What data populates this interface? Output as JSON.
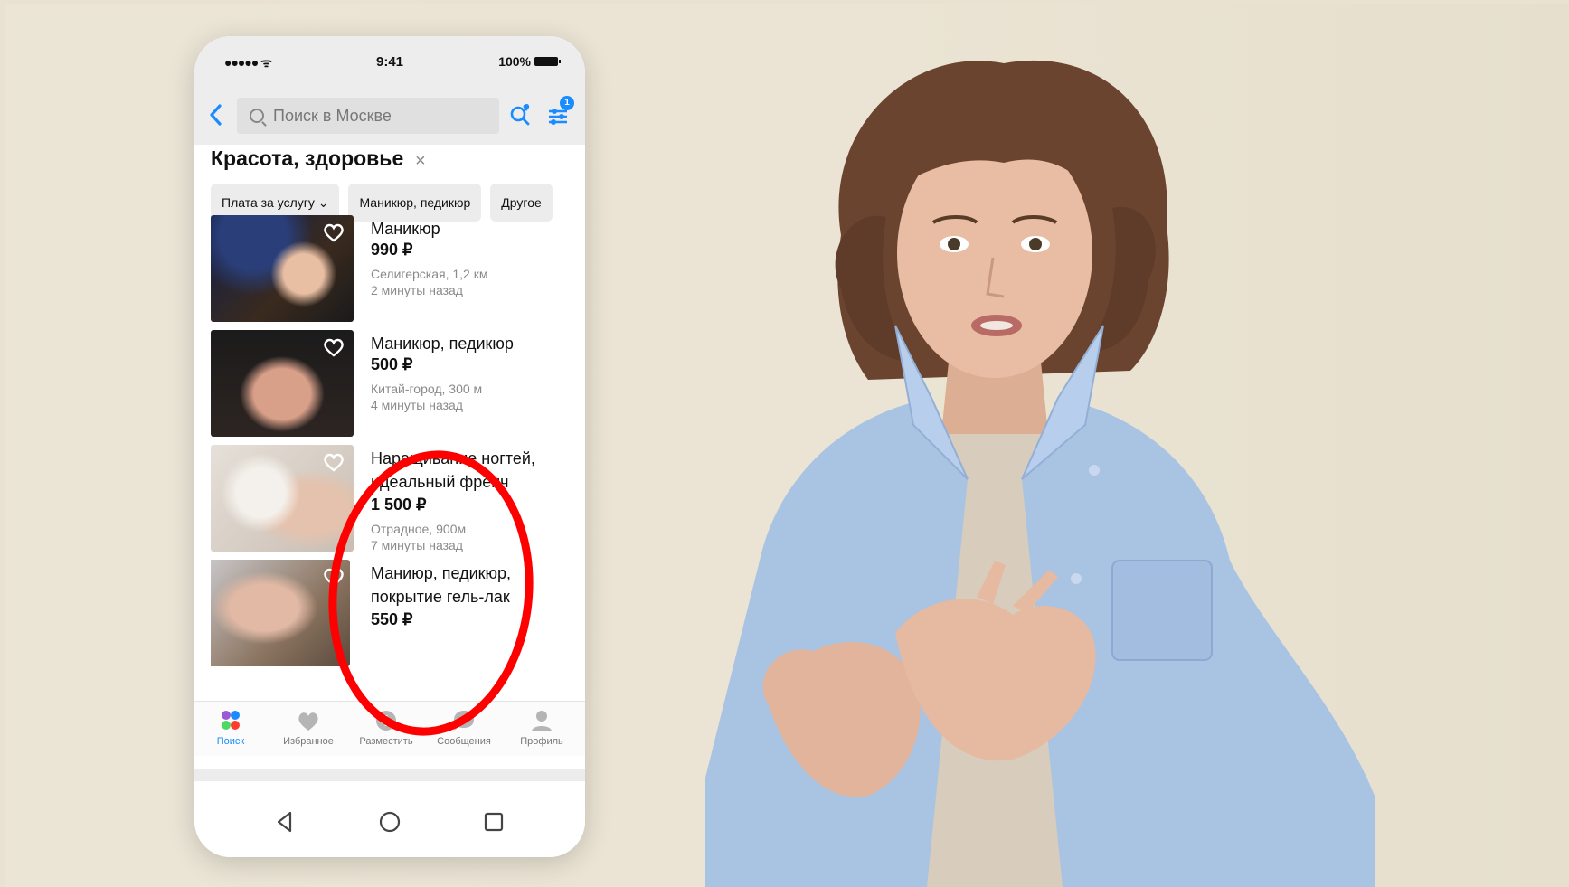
{
  "status_bar": {
    "signal": "●●●●● ᯤ",
    "time": "9:41",
    "battery": "100%"
  },
  "top_bar": {
    "back_icon": "chevron-left-icon",
    "search_placeholder": "Поиск в Москве",
    "saved_search_icon": "search-heart-icon",
    "filters_icon": "sliders-icon",
    "filters_badge": "1"
  },
  "category": {
    "title": "Красота, здоровье",
    "close": "×"
  },
  "chips": [
    {
      "label": "Плата за услугу ⌄"
    },
    {
      "label": "Маникюр, педикюр"
    },
    {
      "label": "Другое"
    }
  ],
  "listings": [
    {
      "title": "Маникюр",
      "price": "990 ₽",
      "address": "Селигерская, 1,2 км",
      "time": "2 минуты назад"
    },
    {
      "title": "Маникюр, педикюр",
      "price": "500 ₽",
      "address": "Китай-город, 300 м",
      "time": "4 минуты назад"
    },
    {
      "title": "Наращивание ногтей, идеальный френч",
      "price": "1 500 ₽",
      "address": "Отрадное, 900м",
      "time": "7 минуты назад"
    },
    {
      "title": "Маниюр, педикюр, покрытие гель-лак",
      "price": "550 ₽",
      "address": "",
      "time": ""
    }
  ],
  "tabs": [
    {
      "label": "Поиск",
      "icon": "search-dots-icon",
      "active": true
    },
    {
      "label": "Избранное",
      "icon": "heart-icon",
      "active": false
    },
    {
      "label": "Разместить",
      "icon": "plus-circle-icon",
      "active": false
    },
    {
      "label": "Сообщения",
      "icon": "chat-icon",
      "active": false
    },
    {
      "label": "Профиль",
      "icon": "user-icon",
      "active": false
    }
  ],
  "system_nav": [
    "back-triangle-icon",
    "home-circle-icon",
    "recents-square-icon"
  ],
  "colors": {
    "accent": "#1a8cff",
    "annotation": "#ff0000",
    "background": "#ebe5d6",
    "shirt": "#a9c3e3"
  }
}
